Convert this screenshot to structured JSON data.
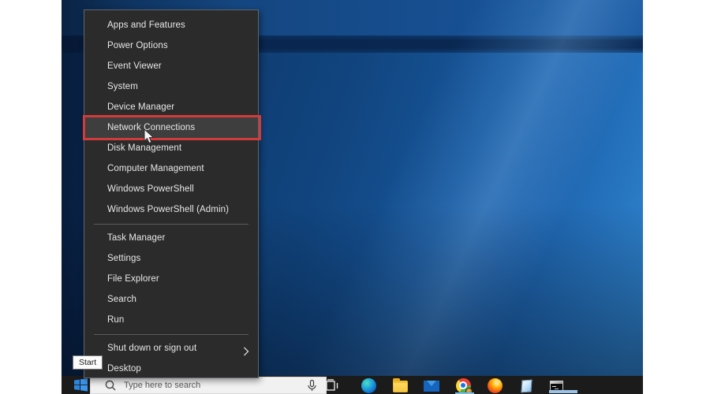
{
  "colors": {
    "highlight_red": "#d23b3b",
    "menu_bg": "#2b2b2b",
    "taskbar_bg": "#1b1b1b",
    "wallpaper_blue": "#11457f",
    "active_underline": "#76b9ed"
  },
  "menu": {
    "groups": [
      {
        "items": [
          "Apps and Features",
          "Power Options",
          "Event Viewer",
          "System",
          "Device Manager",
          "Network Connections",
          "Disk Management",
          "Computer Management",
          "Windows PowerShell",
          "Windows PowerShell (Admin)"
        ]
      },
      {
        "items": [
          "Task Manager",
          "Settings",
          "File Explorer",
          "Search",
          "Run"
        ]
      },
      {
        "items": [
          "Shut down or sign out",
          "Desktop"
        ]
      }
    ],
    "highlighted_item": "Network Connections",
    "submenu_item": "Shut down or sign out"
  },
  "taskbar": {
    "start_tooltip": "Start",
    "search_placeholder": "Type here to search",
    "icons": [
      "start",
      "search",
      "microphone",
      "task-view",
      "edge",
      "file-explorer",
      "mail",
      "chrome",
      "firefox",
      "notepad",
      "command-prompt"
    ]
  }
}
